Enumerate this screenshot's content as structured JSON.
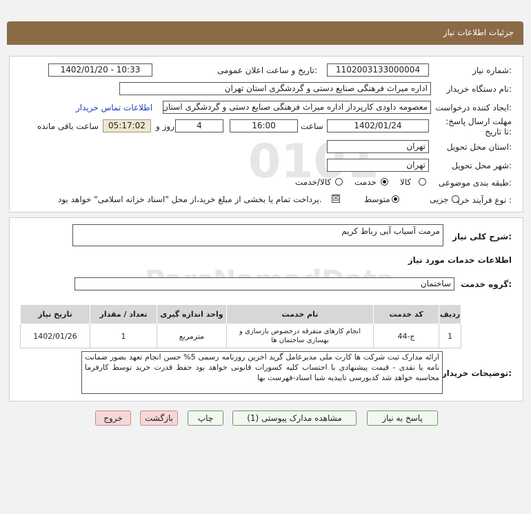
{
  "header": {
    "title": "جزئیات اطلاعات نیاز"
  },
  "form": {
    "need_number_label": "شماره نیاز:",
    "need_number": "1102003133000004",
    "announce_label": "تاریخ و ساعت اعلان عمومی:",
    "announce_value": "1402/01/20 - 10:33",
    "buyer_org_label": "نام دستگاه خریدار:",
    "buyer_org": "اداره میراث فرهنگی  صنایع دستی و گردشگری استان تهران",
    "requester_label": "ایجاد کننده درخواست:",
    "requester": "معصومه داودی کارپرداز اداره میراث فرهنگی  صنایع دستی و گردشگری استان تهران",
    "contact_link": "اطلاعات تماس خریدار",
    "deadline_label": "مهلت ارسال پاسخ: تا تاریخ:",
    "deadline_date": "1402/01/24",
    "time_label": "ساعت",
    "deadline_time": "16:00",
    "day_label": "روز و",
    "days": "4",
    "remaining_time": "05:17:02",
    "remaining_label": "ساعت باقی مانده",
    "delivery_province_label": "استان محل تحویل:",
    "delivery_province": "تهران",
    "delivery_city_label": "شهر محل تحویل:",
    "delivery_city": "تهران",
    "category_label": "طبقه بندی موضوعی:",
    "category_options": [
      "کالا",
      "خدمت",
      "کالا/خدمت"
    ],
    "process_label": "نوع فرآیند خرید :",
    "process_options": [
      "جزیی",
      "متوسط"
    ],
    "payment_note": "پرداخت تمام یا بخشی از مبلغ خرید،از محل \"اسناد خزانه اسلامی\" خواهد بود."
  },
  "description": {
    "label": "شرح کلی نیاز:",
    "value": "مرمت آسیاب آبی رباط کریم"
  },
  "services": {
    "section_title": "اطلاعات خدمات مورد نیاز",
    "group_label": "گروه خدمت:",
    "group_value": "ساختمان",
    "table": {
      "headers": [
        "ردیف",
        "کد خدمت",
        "نام خدمت",
        "واحد اندازه گیری",
        "تعداد / مقدار",
        "تاریخ نیاز"
      ],
      "rows": [
        [
          "1",
          "ج-44",
          "انجام کارهای متفرقه درخصوص بازسازی و بهسازی ساختمان ها",
          "مترمربع",
          "1",
          "1402/01/26"
        ]
      ]
    }
  },
  "buyer_notes": {
    "label": "توضیحات خریدار:",
    "value": "ارائه مدارک ثبت شرکت ها کارت ملی مدیرعامل گرید اخرین روزنامه رسمی 5% حسن انجام تعهد بصور ضمانت نامه یا نقدی - قیمت پیشنهادی با احتساب کلیه کسورات قانونی خواهد بود حفظ قدرت خرید توسط کارفرما محاسبه خواهد شد کدبورسی تاییدیه شبا اسناد-فهرست بها"
  },
  "buttons": {
    "reply": "پاسخ به نیاز",
    "attachments": "مشاهده مدارک پیوستی (1)",
    "print": "چاپ",
    "back": "بازگشت",
    "exit": "خروج"
  }
}
